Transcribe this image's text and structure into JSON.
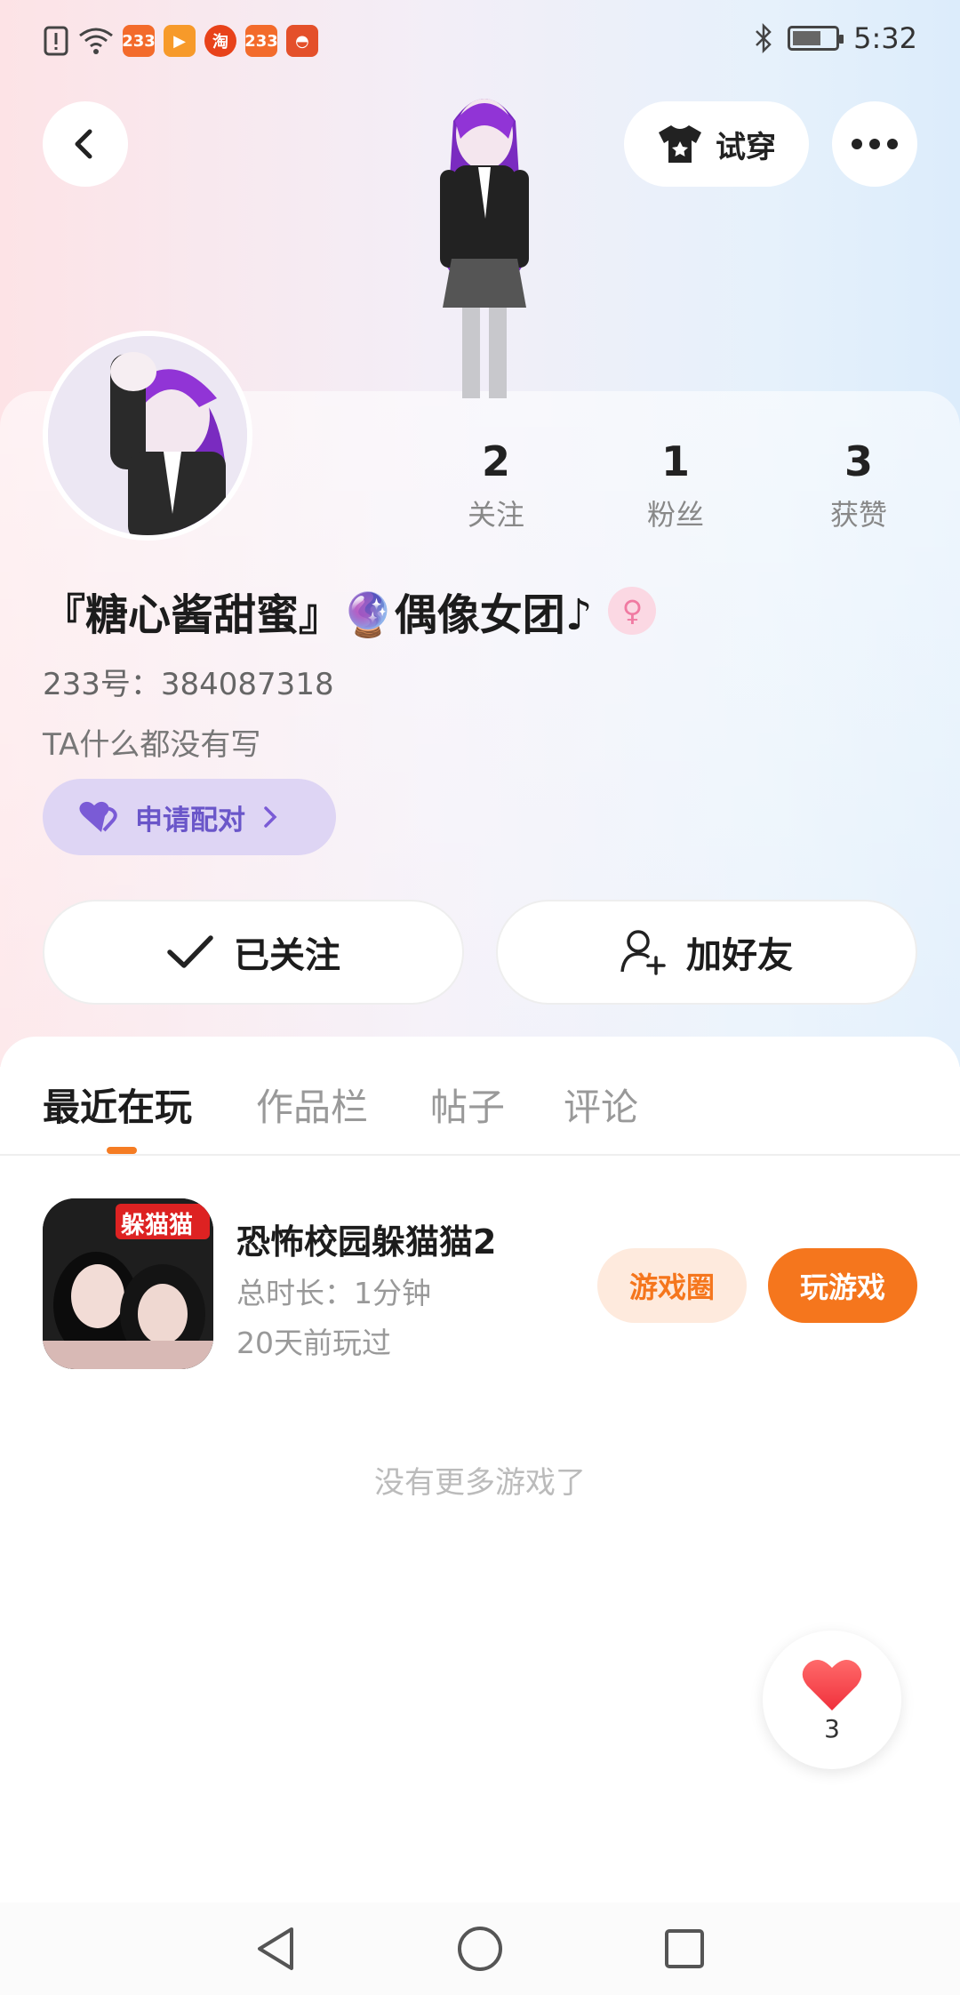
{
  "status_bar": {
    "time": "5:32",
    "notification_icons": [
      "alert-icon",
      "wifi-icon",
      "app-icon-233",
      "app-icon-video",
      "app-icon-taobao",
      "app-icon-233",
      "app-icon-car"
    ]
  },
  "header": {
    "back_icon": "chevron-left-icon",
    "tryon_label": "试穿",
    "more_icon": "more-icon"
  },
  "profile": {
    "stats": [
      {
        "value": "2",
        "label": "关注"
      },
      {
        "value": "1",
        "label": "粉丝"
      },
      {
        "value": "3",
        "label": "获赞"
      }
    ],
    "nickname": "『糖心酱甜蜜』🔮偶像女团♪",
    "gender_symbol": "♀",
    "uid": "233号：384087318",
    "bio": "TA什么都没有写",
    "pair_button": "申请配对"
  },
  "actions": {
    "followed_label": "已关注",
    "add_friend_label": "加好友"
  },
  "tabs": [
    {
      "label": "最近在玩",
      "active": true
    },
    {
      "label": "作品栏",
      "active": false
    },
    {
      "label": "帖子",
      "active": false
    },
    {
      "label": "评论",
      "active": false
    }
  ],
  "games": [
    {
      "title": "恐怖校园躲猫猫2",
      "icon_text": "躲猫猫",
      "duration": "总时长：1分钟",
      "last_played": "20天前玩过",
      "circle_button": "游戏圈",
      "play_button": "玩游戏"
    }
  ],
  "no_more_text": "没有更多游戏了",
  "like_fab": {
    "count": "3"
  },
  "colors": {
    "accent": "#f5761d",
    "pair_bg": "#ded5f4",
    "pair_text": "#6a56c9"
  }
}
